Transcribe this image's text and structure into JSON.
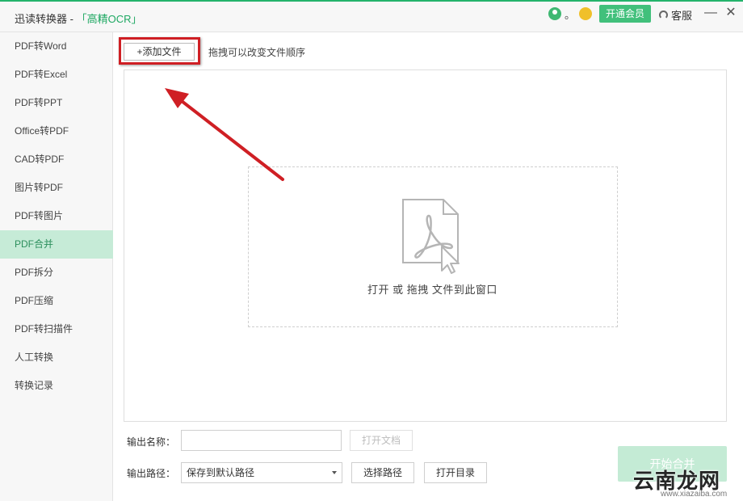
{
  "app": {
    "title": "迅读转换器 - ",
    "ocr_bracket_open": "「",
    "ocr_label": "高精OCR",
    "ocr_bracket_close": "」"
  },
  "header": {
    "user_dot": "。",
    "vip_label": "开通会员",
    "service_label": "客服",
    "minimize_glyph": "—",
    "close_glyph": "✕"
  },
  "sidebar": {
    "items": [
      {
        "label": "PDF转Word"
      },
      {
        "label": "PDF转Excel"
      },
      {
        "label": "PDF转PPT"
      },
      {
        "label": "Office转PDF"
      },
      {
        "label": "CAD转PDF"
      },
      {
        "label": "图片转PDF"
      },
      {
        "label": "PDF转图片"
      },
      {
        "label": "PDF合并",
        "active": true
      },
      {
        "label": "PDF拆分"
      },
      {
        "label": "PDF压缩"
      },
      {
        "label": "PDF转扫描件"
      },
      {
        "label": "人工转换"
      },
      {
        "label": "转换记录"
      }
    ]
  },
  "toolbar": {
    "add_file_label": "+添加文件",
    "drag_tip": "拖拽可以改变文件顺序"
  },
  "dropzone": {
    "text": "打开 或 拖拽 文件到此窗口",
    "icon": "pdf-file-icon"
  },
  "form": {
    "name_label": "输出名称：",
    "name_value": "",
    "open_doc_label": "打开文档",
    "path_label": "输出路径：",
    "path_value": "保存到默认路径",
    "choose_path_label": "选择路径",
    "open_dir_label": "打开目录"
  },
  "action": {
    "start_label": "开始合并"
  },
  "watermark": {
    "text": "云南龙网",
    "url": "www.xiazaiba.com"
  },
  "colors": {
    "accent": "#41c07b",
    "active_bg": "#c6ebd7",
    "highlight": "#cf1f24"
  }
}
